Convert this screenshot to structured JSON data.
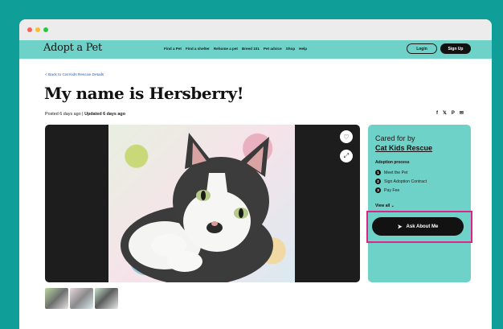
{
  "nav": {
    "logo": "Adopt a Pet",
    "links": [
      "Find a Pet",
      "Find a shelter",
      "Rehome a pet",
      "Breed 101",
      "Pet advice",
      "Shop",
      "Help"
    ],
    "login_label": "Login",
    "signup_label": "Sign Up"
  },
  "page": {
    "back_label": "<  Back to Cat Kids Rescue Details",
    "title": "My name is Hersberry!",
    "posted": "Posted 6 days ago",
    "separator": "|",
    "updated": "Updated 6 days ago"
  },
  "share": {
    "facebook": "f",
    "twitter": "𝕏",
    "pinterest": "P",
    "email": "✉"
  },
  "photo": {
    "favorite_icon": "♡",
    "expand_icon": "⤢"
  },
  "thumbnails": [
    "thumb-1",
    "thumb-2",
    "thumb-3"
  ],
  "sidebar": {
    "cared_by": "Cared for by",
    "rescue_name": "Cat Kids Rescue",
    "process_title": "Adoption process",
    "steps": [
      {
        "num": "1",
        "label": "Meet the Pet"
      },
      {
        "num": "2",
        "label": "Sign Adoption Contract"
      },
      {
        "num": "3",
        "label": "Pay Fee"
      }
    ],
    "view_all": "View all ⌄"
  },
  "cta": {
    "icon": "➤",
    "label": "Ask About Me"
  },
  "colors": {
    "background": "#0f9e98",
    "accent": "#6fd2c8",
    "highlight": "#e0218a",
    "button": "#121212"
  }
}
